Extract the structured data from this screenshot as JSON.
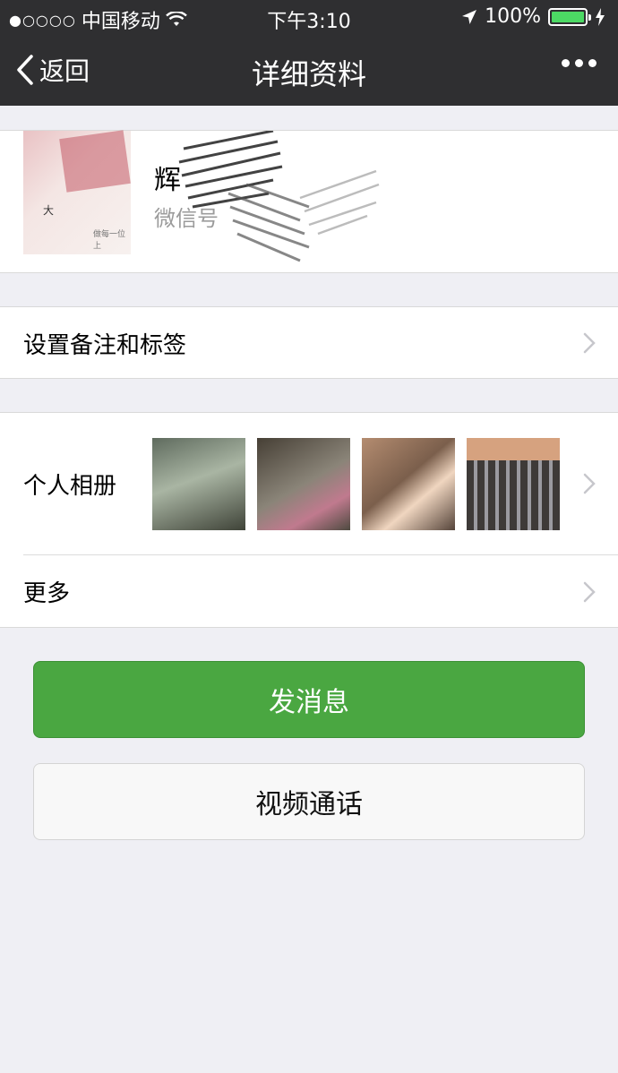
{
  "status_bar": {
    "signal": "●○○○○",
    "carrier": "中国移动",
    "time": "下午3:10",
    "battery": "100%"
  },
  "nav": {
    "back_label": "返回",
    "title": "详细资料"
  },
  "profile": {
    "name": "辉",
    "wechat_id_label": "微信号",
    "avatar_caption_1": "大",
    "avatar_caption_2": "做每一位上"
  },
  "rows": {
    "remark_label": "设置备注和标签",
    "album_label": "个人相册",
    "more_label": "更多"
  },
  "album": {
    "photo_count": 4
  },
  "buttons": {
    "send_message": "发消息",
    "video_call": "视频通话"
  },
  "colors": {
    "nav_background": "#2f2f31",
    "primary_green": "#4aa741",
    "battery_green": "#4cd964",
    "page_background": "#efeff4"
  }
}
